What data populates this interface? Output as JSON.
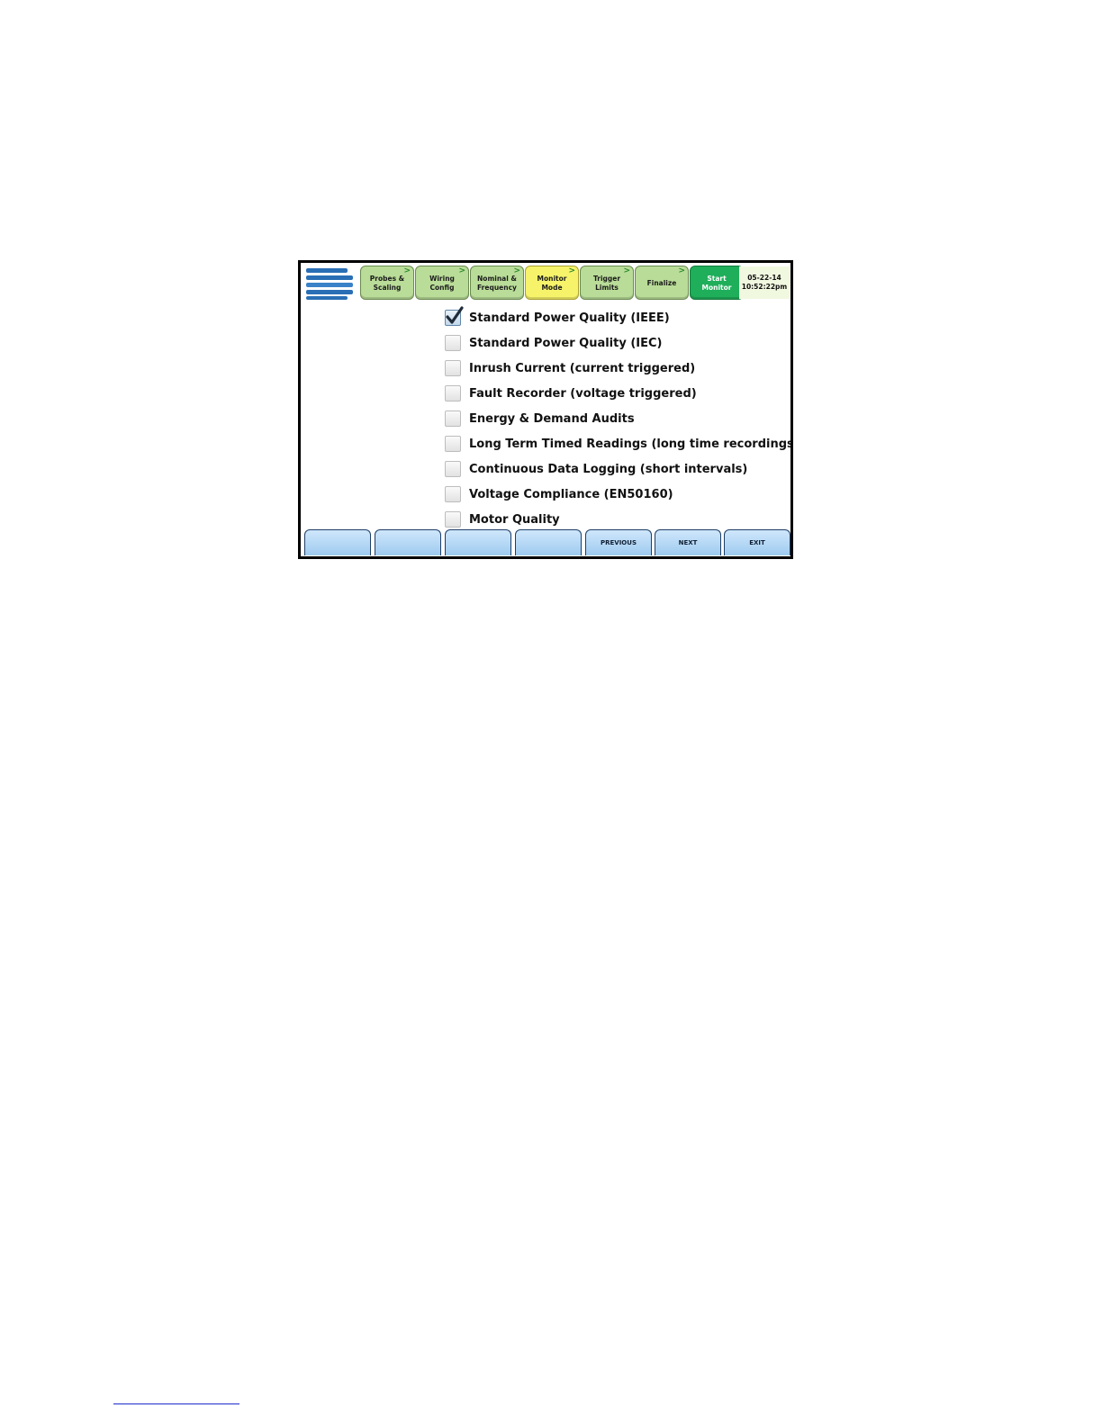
{
  "topbar": {
    "steps": [
      {
        "label": "Probes &\nScaling",
        "state": "done",
        "chevron": ">"
      },
      {
        "label": "Wiring\nConfig",
        "state": "done",
        "chevron": ">"
      },
      {
        "label": "Nominal &\nFrequency",
        "state": "done",
        "chevron": ">"
      },
      {
        "label": "Monitor\nMode",
        "state": "current",
        "chevron": ">"
      },
      {
        "label": "Trigger\nLimits",
        "state": "done",
        "chevron": ">"
      },
      {
        "label": "Finalize",
        "state": "done",
        "chevron": ">"
      },
      {
        "label": "Start\nMonitor",
        "state": "start",
        "chevron": ""
      }
    ],
    "date": "05-22-14",
    "time": "10:52:22pm"
  },
  "options": [
    {
      "label": "Standard Power Quality (IEEE)",
      "checked": true
    },
    {
      "label": "Standard Power Quality (IEC)",
      "checked": false
    },
    {
      "label": "Inrush Current (current triggered)",
      "checked": false
    },
    {
      "label": "Fault Recorder (voltage triggered)",
      "checked": false
    },
    {
      "label": "Energy & Demand Audits",
      "checked": false
    },
    {
      "label": "Long Term Timed Readings (long time recordings)",
      "checked": false
    },
    {
      "label": "Continuous Data Logging (short intervals)",
      "checked": false
    },
    {
      "label": "Voltage Compliance (EN50160)",
      "checked": false
    },
    {
      "label": "Motor Quality",
      "checked": false
    }
  ],
  "softkeys": [
    "",
    "",
    "",
    "",
    "PREVIOUS",
    "NEXT",
    "EXIT"
  ],
  "colors": {
    "step_done": "#b9dc98",
    "step_current": "#f6f36a",
    "step_start": "#1fae5a",
    "softkey": "#9ecbf0",
    "logo_blue": "#2a6fb5"
  }
}
